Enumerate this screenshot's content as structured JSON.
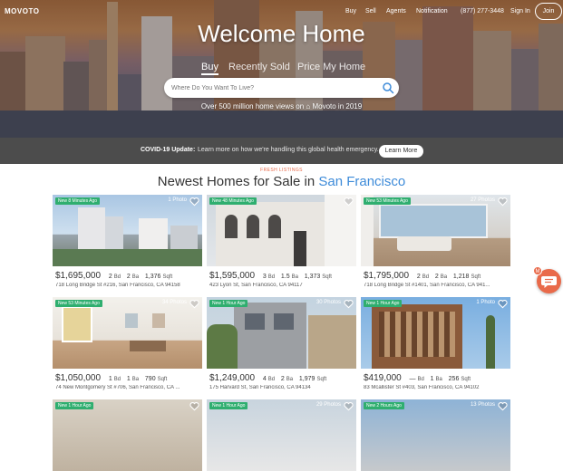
{
  "header": {
    "logo": "MOVOTO",
    "nav": [
      "Buy",
      "Sell",
      "Agents",
      "Notification",
      "(877) 277-3448",
      "Sign In"
    ],
    "join_label": "Join"
  },
  "hero": {
    "title": "Welcome Home",
    "tabs": [
      "Buy",
      "Recently Sold",
      "Price My Home"
    ],
    "search_placeholder": "Where Do You Want To Live?",
    "subtitle": "Over 500 million home views on ⌂ Movoto in 2019"
  },
  "covid": {
    "title": "COVID-19 Update:",
    "text": "Learn more on how we're handling this global health emergency.",
    "button_label": "Learn More"
  },
  "section": {
    "eyebrow": "FRESH LISTINGS",
    "title_prefix": "Newest Homes for Sale in",
    "city": "San Francisco"
  },
  "listings": [
    {
      "badge": "New 8 Minutes Ago",
      "photos": "1 Photo",
      "price": "$1,695,000",
      "beds": "2",
      "baths": "2",
      "sqft": "1,376",
      "address": "718 Long Bridge St #216, San Francisco, CA 94158"
    },
    {
      "badge": "New 48 Minutes Ago",
      "photos": "",
      "price": "$1,595,000",
      "beds": "3",
      "baths": "1.5",
      "sqft": "1,373",
      "address": "423 Lyon St, San Francisco, CA 94117"
    },
    {
      "badge": "New 53 Minutes Ago",
      "photos": "27 Photos",
      "price": "$1,795,000",
      "beds": "2",
      "baths": "2",
      "sqft": "1,218",
      "address": "718 Long Bridge St #1401, San Francisco, CA 941..."
    },
    {
      "badge": "New 53 Minutes Ago",
      "photos": "34 Photos",
      "price": "$1,050,000",
      "beds": "1",
      "baths": "1",
      "sqft": "790",
      "address": "74 New Montgomery St #706, San Francisco, CA ..."
    },
    {
      "badge": "New 1 Hour Ago",
      "photos": "30 Photos",
      "price": "$1,249,000",
      "beds": "4",
      "baths": "2",
      "sqft": "1,979",
      "address": "175 Harvard St, San Francisco, CA 94134"
    },
    {
      "badge": "New 1 Hour Ago",
      "photos": "1 Photo",
      "price": "$419,000",
      "beds": "—",
      "baths": "1",
      "sqft": "256",
      "address": "83 Mcallister St #403, San Francisco, CA 94102"
    },
    {
      "badge": "New 1 Hour Ago",
      "photos": "",
      "price": "",
      "beds": "",
      "baths": "",
      "sqft": "",
      "address": ""
    },
    {
      "badge": "New 1 Hour Ago",
      "photos": "29 Photos",
      "price": "",
      "beds": "",
      "baths": "",
      "sqft": "",
      "address": ""
    },
    {
      "badge": "New 2 Hours Ago",
      "photos": "13 Photos",
      "price": "",
      "beds": "",
      "baths": "",
      "sqft": "",
      "address": ""
    }
  ],
  "labels": {
    "bd": "Bd",
    "ba": "Ba",
    "sqft": "Sqft"
  },
  "chat": {
    "badge": "M"
  },
  "colors": {
    "accent": "#3d8bd9",
    "badge_green": "#2fae6f",
    "chat_orange": "#e96a4a",
    "covid_bar": "#4c4c4c"
  }
}
